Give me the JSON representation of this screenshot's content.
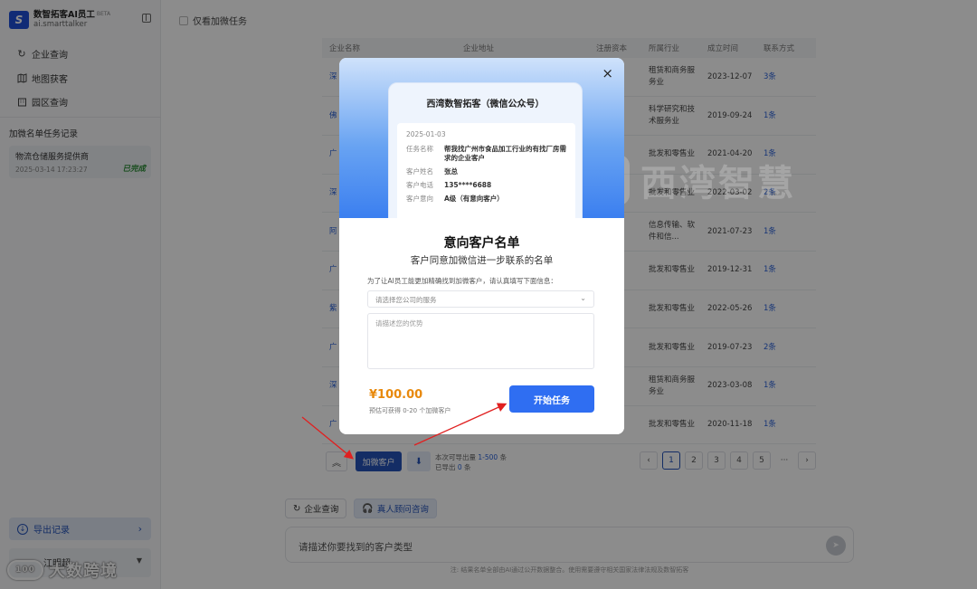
{
  "brand": {
    "name": "数智拓客AI员工",
    "beta": "BETA",
    "url": "ai.smarttalker",
    "logo_text": "S"
  },
  "nav": [
    {
      "label": "企业查询",
      "icon": "refresh-icon"
    },
    {
      "label": "地图获客",
      "icon": "map-icon"
    },
    {
      "label": "园区查询",
      "icon": "building-icon"
    }
  ],
  "task_section": {
    "title": "加微名单任务记录",
    "task": {
      "name": "物流仓储服务提供商",
      "time": "2025-03-14 17:23:27",
      "status": "已完成"
    }
  },
  "export": {
    "label": "导出记录"
  },
  "user": {
    "name": "江明超"
  },
  "watermark_bl": {
    "text": "大数跨境",
    "mark_text": "100"
  },
  "filter": {
    "label": "仅看加微任务"
  },
  "table": {
    "headers": [
      "企业名称",
      "企业地址",
      "注册资本",
      "所属行业",
      "成立时间",
      "联系方式"
    ],
    "rows": [
      {
        "name": "深",
        "industry": "租赁和商务服务业",
        "date": "2023-12-07",
        "contact": "3条"
      },
      {
        "name": "佛",
        "industry": "科学研究和技术服务业",
        "date": "2019-09-24",
        "contact": "1条"
      },
      {
        "name": "广",
        "industry": "批发和零售业",
        "date": "2021-04-20",
        "contact": "1条"
      },
      {
        "name": "深",
        "industry": "批发和零售业",
        "date": "2022-03-02",
        "contact": "2条"
      },
      {
        "name": "阿",
        "industry": "信息传输、软件和信...",
        "date": "2021-07-23",
        "contact": "1条"
      },
      {
        "name": "广",
        "industry": "批发和零售业",
        "date": "2019-12-31",
        "contact": "1条"
      },
      {
        "name": "紫",
        "industry": "批发和零售业",
        "date": "2022-05-26",
        "contact": "1条"
      },
      {
        "name": "广",
        "industry": "批发和零售业",
        "date": "2019-07-23",
        "contact": "2条"
      },
      {
        "name": "深",
        "industry": "租赁和商务服务业",
        "date": "2023-03-08",
        "contact": "1条"
      },
      {
        "name": "广",
        "industry": "批发和零售业",
        "date": "2020-11-18",
        "contact": "1条"
      }
    ]
  },
  "pager": {
    "add_wechat": "加微客户",
    "export_line1_prefix": "本次可导出量 ",
    "export_line1_value": "1-500",
    "export_line1_suffix": " 条",
    "export_line2_prefix": "已导出 ",
    "export_line2_value": "0",
    "export_line2_suffix": " 条",
    "pages": [
      "‹",
      "1",
      "2",
      "3",
      "4",
      "5",
      "···",
      "›"
    ],
    "active_page": "1"
  },
  "tabs": [
    {
      "label": "企业查询",
      "icon": "refresh-icon"
    },
    {
      "label": "真人顾问咨询",
      "icon": "headset-icon"
    }
  ],
  "chat": {
    "placeholder": "请描述你要找到的客户类型"
  },
  "disclaimer": "注: 结果名单全部由AI通过公开数据整合。使用需要遵守相关国家法律法规及数智拓客",
  "bg_watermark": {
    "text": "西湾智慧"
  },
  "modal": {
    "card": {
      "title": "西湾数智拓客（微信公众号）",
      "date": "2025-01-03",
      "rows": [
        {
          "k": "任务名称",
          "v": "帮我找广州市食品加工行业的有找厂房需求的企业客户"
        },
        {
          "k": "客户姓名",
          "v": "张总"
        },
        {
          "k": "客户电话",
          "v": "135****6688"
        },
        {
          "k": "客户意向",
          "v": "A级（有意向客户）"
        }
      ]
    },
    "title": "意向客户名单",
    "subtitle": "客户同意加微信进一步联系的名单",
    "hint": "为了让AI员工能更加精确找到加微客户，请认真填写下面信息：",
    "select_placeholder": "请选择您公司的服务",
    "textarea_placeholder": "请描述您的优势",
    "price": "¥100.00",
    "price_note": "预估可获得 0-20 个加微客户",
    "start_button": "开始任务",
    "close": "×"
  }
}
